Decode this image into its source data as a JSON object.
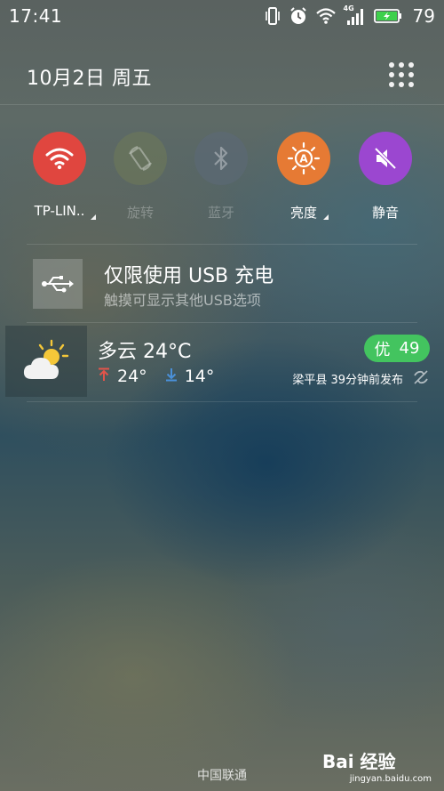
{
  "status_bar": {
    "time": "17:41",
    "network_type": "4G",
    "battery_level": "79",
    "icons": [
      "vibrate-icon",
      "alarm-icon",
      "wifi-icon",
      "signal-icon",
      "battery-charging-icon"
    ]
  },
  "header": {
    "date": "10月2日  周五",
    "grid_icon": "app-grid-icon"
  },
  "toggles": [
    {
      "label": "TP-LIN..",
      "icon": "wifi-icon",
      "active": true,
      "color": "#e0463f"
    },
    {
      "label": "旋转",
      "icon": "rotate-icon",
      "active": false,
      "color": "#6f7a58"
    },
    {
      "label": "蓝牙",
      "icon": "bluetooth-icon",
      "active": false,
      "color": "#5c6976"
    },
    {
      "label": "亮度",
      "icon": "brightness-icon",
      "active": true,
      "color": "#e67a34"
    },
    {
      "label": "静音",
      "icon": "mute-icon",
      "active": true,
      "color": "#9b47d0"
    }
  ],
  "usb_notification": {
    "title": "仅限使用 USB 充电",
    "subtitle": "触摸可显示其他USB选项",
    "icon": "usb-icon"
  },
  "weather": {
    "condition": "多云 24°C",
    "high": "24°",
    "low": "14°",
    "aqi_label": "优",
    "aqi_value": "49",
    "aqi_color": "#43c45f",
    "source": "梁平县 39分钟前发布",
    "icon": "partly-cloudy-icon"
  },
  "footer": {
    "carrier": "中国联通"
  },
  "watermark": {
    "logo": "Bai  经验",
    "url": "jingyan.baidu.com"
  }
}
